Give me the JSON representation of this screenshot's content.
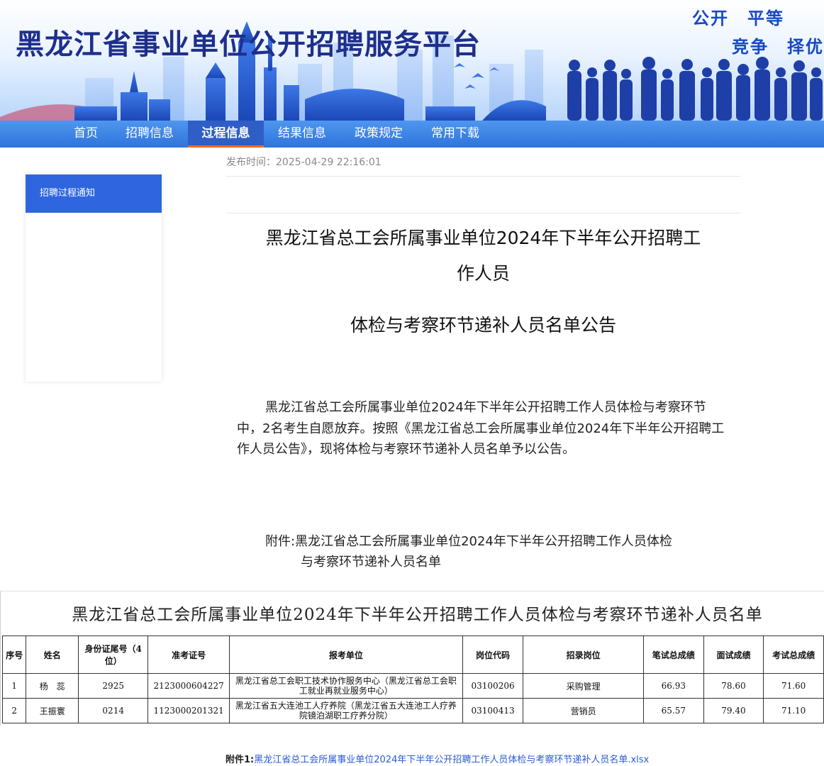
{
  "header": {
    "site_title": "黑龙江省事业单位公开招聘服务平台",
    "slogan_line1": "公开　平等",
    "slogan_line2": "竞争　择优",
    "brand_color": "#1e2f8c"
  },
  "nav": {
    "items": [
      {
        "label": "首页",
        "active": false
      },
      {
        "label": "招聘信息",
        "active": false
      },
      {
        "label": "过程信息",
        "active": true
      },
      {
        "label": "结果信息",
        "active": false
      },
      {
        "label": "政策规定",
        "active": false
      },
      {
        "label": "常用下载",
        "active": false
      }
    ],
    "accent_color": "#ff6a1a"
  },
  "sidebar": {
    "items": [
      {
        "label": "招聘过程通知",
        "active": true
      }
    ]
  },
  "article": {
    "publish_time": "发布时间：2025-04-29 22:16:01",
    "title_line1": "黑龙江省总工会所属事业单位2024年下半年公开招聘工",
    "title_line2": "作人员",
    "title_line3": "体检与考察环节递补人员名单公告",
    "body": "黑龙江省总工会所属事业单位2024年下半年公开招聘工作人员体检与考察环节中，2名考生自愿放弃。按照《黑龙江省总工会所属事业单位2024年下半年公开招聘工作人员公告》，现将体检与考察环节递补人员名单予以公告。",
    "attachment_line1": "附件:黑龙江省总工会所属事业单位2024年下半年公开招聘工作人员体检",
    "attachment_line2": "与考察环节递补人员名单"
  },
  "roster": {
    "title": "黑龙江省总工会所属事业单位2024年下半年公开招聘工作人员体检与考察环节递补人员名单",
    "headers": [
      "序号",
      "姓名",
      "身份证尾号（4位）",
      "准考证号",
      "报考单位",
      "岗位代码",
      "招录岗位",
      "笔试总成绩",
      "面试成绩",
      "考试总成绩"
    ],
    "rows": [
      {
        "no": "1",
        "name": "杨　蕊",
        "id_tail": "2925",
        "exam_no": "2123000604227",
        "unit": "黑龙江省总工会职工技术协作服务中心（黑龙江省总工会职工就业再就业服务中心）",
        "post_code": "03100206",
        "post": "采购管理",
        "written": "66.93",
        "interview": "78.60",
        "total": "71.60"
      },
      {
        "no": "2",
        "name": "王振寰",
        "id_tail": "0214",
        "exam_no": "1123000201321",
        "unit": "黑龙江省五大连池工人疗养院（黑龙江省五大连池工人疗养院镜泊湖职工疗养分院）",
        "post_code": "03100413",
        "post": "营销员",
        "written": "65.57",
        "interview": "79.40",
        "total": "71.10"
      }
    ]
  },
  "attachment": {
    "label": "附件1:",
    "filename": "黑龙江省总工会所属事业单位2024年下半年公开招聘工作人员体检与考察环节递补人员名单.xlsx"
  }
}
